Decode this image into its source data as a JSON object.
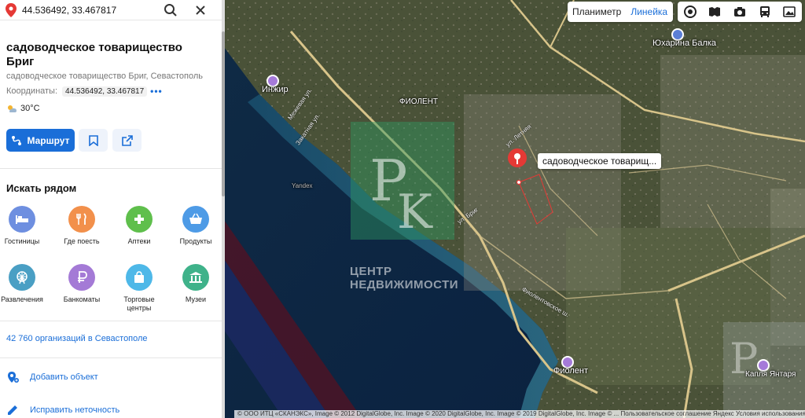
{
  "search": {
    "value": "44.536492, 33.467817"
  },
  "place": {
    "title": "садоводческое товарищество Бриг",
    "subtitle": "садоводческое товарищество Бриг, Севастополь",
    "coords_label": "Координаты:",
    "coords_value": "44.536492, 33.467817",
    "weather": "30°C"
  },
  "actions": {
    "route_label": "Маршрут"
  },
  "nearby": {
    "title": "Искать рядом",
    "categories": [
      {
        "label": "Гостиницы",
        "icon": "bed-icon",
        "color": "#6e8fe0"
      },
      {
        "label": "Где поесть",
        "icon": "fork-knife-icon",
        "color": "#f2904b"
      },
      {
        "label": "Аптеки",
        "icon": "plus-icon",
        "color": "#5fbf4c"
      },
      {
        "label": "Продукты",
        "icon": "basket-icon",
        "color": "#4e9be6"
      },
      {
        "label": "Развлечения",
        "icon": "ferris-wheel-icon",
        "color": "#4a9fc4"
      },
      {
        "label": "Банкоматы",
        "icon": "ruble-icon",
        "color": "#a47ad6"
      },
      {
        "label": "Торговые центры",
        "icon": "shopping-bag-icon",
        "color": "#4eb8e8"
      },
      {
        "label": "Музеи",
        "icon": "museum-icon",
        "color": "#3fb28a"
      }
    ]
  },
  "orgs_link": "42 760 организаций в Севастополе",
  "bottom_actions": [
    {
      "label": "Добавить объект",
      "icon": "add-place-icon"
    },
    {
      "label": "Исправить неточность",
      "icon": "edit-icon"
    }
  ],
  "map": {
    "controls": {
      "planimeter": "Планиметр",
      "ruler": "Линейка"
    },
    "layer_icons": [
      "traffic-icon",
      "panorama-icon",
      "camera-icon",
      "transit-icon",
      "image-layer-icon"
    ],
    "tooltip": "садоводческое товарищ...",
    "labels": {
      "inzhir": "Инжир",
      "fiolent_top": "ФИОЛЕНТ",
      "yuharina": "Юхарина Балка",
      "fiolent_bottom": "Фиолент",
      "kapla": "Капля Янтаря",
      "yandex": "Yandex"
    },
    "watermark": {
      "letters": "РК",
      "line1": "ЦЕНТР",
      "line2": "НЕДВИЖИМОСТИ"
    },
    "copyright": "© ООО ИТЦ «СКАНЭКС», Image © 2012 DigitalGlobe, Inc. Image © 2020 DigitalGlobe, Inc. Image © 2019 DigitalGlobe, Inc. Image © ... Пользовательское соглашение  Яндекс  Условия использования",
    "marker_color": "#e53935"
  }
}
